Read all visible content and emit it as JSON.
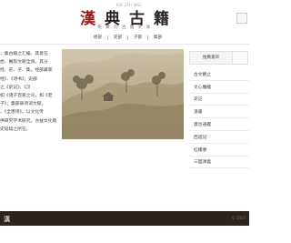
{
  "header": {
    "site_en": "GU ZHI WEI",
    "title_chars": [
      "漢",
      "典",
      "古",
      "籍"
    ],
    "subtitle": "免 費 的 古 籍 文 庫"
  },
  "nav": {
    "items": [
      "經部",
      "史部",
      "子部",
      "集部"
    ]
  },
  "article": {
    "lines": [
      "，集古籍之汇编，其意在",
      "想，展现文献全貌。其分",
      "经、史、子、集，经部藏家",
      "经》、《诗书》；史部",
      "之《史记》、《汉",
      "如《诸子百家之论，如《老",
      "子》；集部录诗词文赋，",
      "，《全唐诗》。以文化传",
      "供研究学术研究，亦益文化教",
      "史延续之所在。"
    ]
  },
  "sidebar": {
    "tabs": [
      "推薦書目",
      ""
    ],
    "items": [
      "古文觀止",
      "文心雕龍",
      "史記",
      "漢書",
      "資治通鑑",
      "西遊記",
      "紅樓夢",
      "三國演義"
    ]
  },
  "footer": {
    "logo": "漢",
    "right_text": "© 2023"
  },
  "colors": {
    "accent": "#9c1c17",
    "dark": "#2b2320",
    "footer_bg": "#2a2320"
  }
}
